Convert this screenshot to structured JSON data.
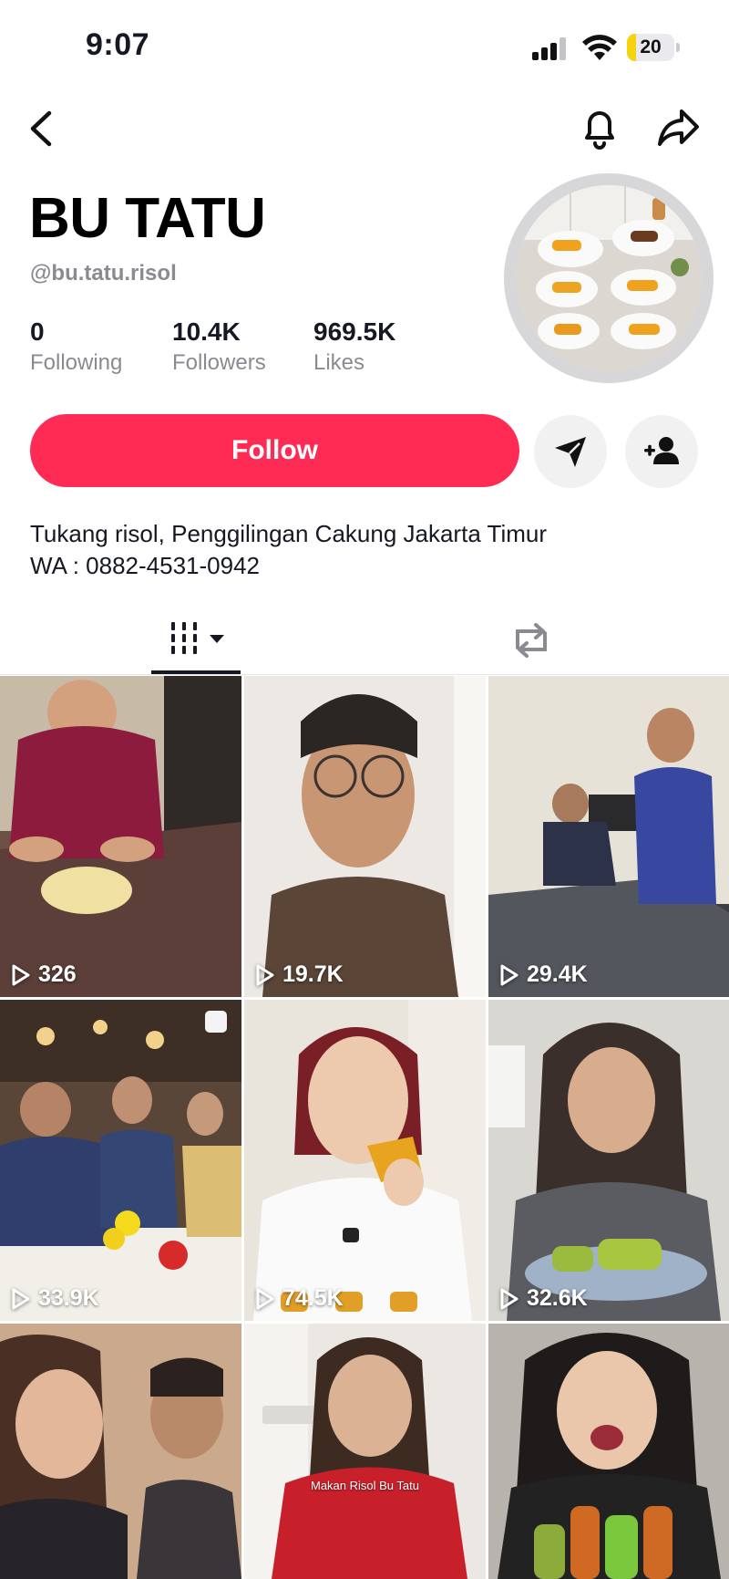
{
  "status_bar": {
    "time": "9:07",
    "battery": "20",
    "battery_level": 0.2
  },
  "nav": {
    "back_icon": "chevron-left-icon",
    "bell_icon": "bell-icon",
    "share_icon": "share-arrow-icon"
  },
  "profile": {
    "name": "BU TATU",
    "handle": "@bu.tatu.risol",
    "stats": [
      {
        "value": "0",
        "label": "Following"
      },
      {
        "value": "10.4K",
        "label": "Followers"
      },
      {
        "value": "969.5K",
        "label": "Likes"
      }
    ],
    "bio_line1": "Tukang risol, Penggilingan Cakung Jakarta Timur",
    "bio_line2": "WA : 0882-4531-0942"
  },
  "actions": {
    "follow_label": "Follow",
    "message_icon": "send-icon",
    "add_friend_icon": "add-user-icon"
  },
  "tabs": [
    {
      "name": "videos-tab",
      "icon": "grid-icon",
      "active": true
    },
    {
      "name": "reposts-tab",
      "icon": "repost-icon",
      "active": false
    }
  ],
  "videos": [
    {
      "views": "326"
    },
    {
      "views": "19.7K"
    },
    {
      "views": "29.4K"
    },
    {
      "views": "33.9K"
    },
    {
      "views": "74.5K"
    },
    {
      "views": "32.6K"
    },
    {
      "views": ""
    },
    {
      "views": "",
      "caption": "Makan Risol Bu Tatu"
    },
    {
      "views": ""
    }
  ],
  "colors": {
    "accent": "#fe2c55",
    "text": "#161823",
    "muted": "#8a8b91"
  }
}
